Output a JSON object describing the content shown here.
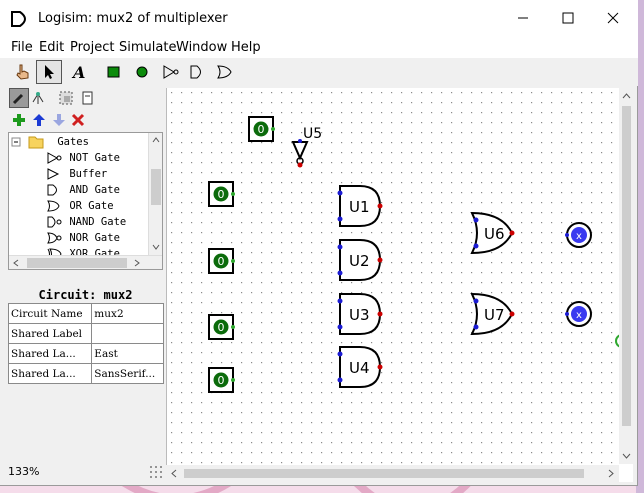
{
  "window": {
    "title": "Logisim: mux2 of multiplexer"
  },
  "menu": [
    "File",
    "Edit",
    "Project",
    "Simulate",
    "Window",
    "Help"
  ],
  "tree": {
    "folder": "Gates",
    "items": [
      "NOT Gate",
      "Buffer",
      "AND Gate",
      "OR Gate",
      "NAND Gate",
      "NOR Gate",
      "XOR Gate"
    ]
  },
  "circuit_title": "Circuit: mux2",
  "attributes": [
    [
      "Circuit Name",
      "mux2"
    ],
    [
      "Shared Label",
      ""
    ],
    [
      "Shared La...",
      "East"
    ],
    [
      "Shared La...",
      "SansSerif..."
    ]
  ],
  "zoom": "133%",
  "canvas": {
    "inputs": [
      "0",
      "0",
      "0",
      "0",
      "0"
    ],
    "not_label": "U5",
    "and_labels": [
      "U1",
      "U2",
      "U3",
      "U4"
    ],
    "or_labels": [
      "U6",
      "U7"
    ],
    "outputs": [
      "x",
      "x"
    ]
  },
  "colors": {
    "wire_green": "#2fa82f",
    "pin_green": "#0b6b0b",
    "output_blue": "#3a3af0",
    "port_red": "#cc0000",
    "port_blue": "#1b1bd4"
  }
}
